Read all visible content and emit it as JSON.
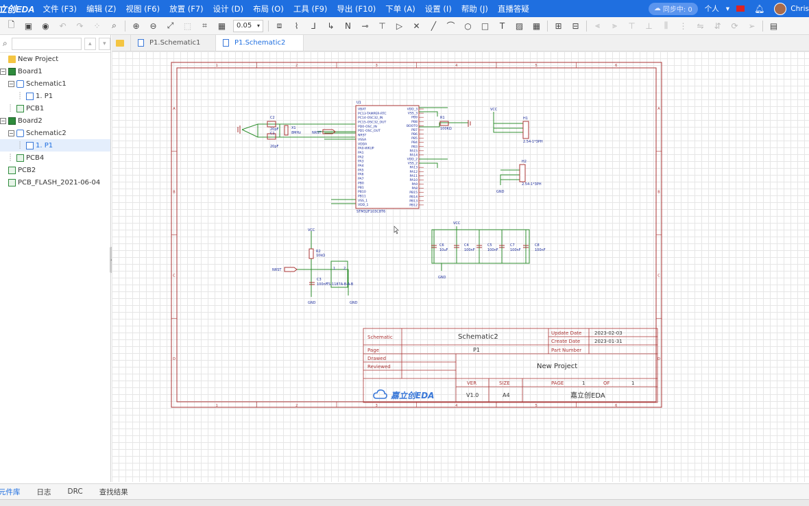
{
  "menubar": {
    "logo": "立创EDA",
    "items": [
      "文件 (F3)",
      "编辑 (Z)",
      "视图 (F6)",
      "放置 (F7)",
      "设计 (D)",
      "布局 (O)",
      "工具 (F9)",
      "导出 (F10)",
      "下单 (A)",
      "设置 (I)",
      "帮助 (J)",
      "直播答疑"
    ],
    "sync_label": "同步中: 0",
    "personal_label": "个人",
    "user_name": "Chris"
  },
  "toolbar": {
    "zoom_value": "0.05"
  },
  "left_panel": {
    "tree": [
      {
        "label": "New Project",
        "type": "folder",
        "level": 0
      },
      {
        "label": "Board1",
        "type": "board",
        "level": 0
      },
      {
        "label": "Schematic1",
        "type": "schematic",
        "level": 1
      },
      {
        "label": "1. P1",
        "type": "page",
        "level": 2
      },
      {
        "label": "PCB1",
        "type": "pcb",
        "level": 1
      },
      {
        "label": "Board2",
        "type": "board",
        "level": 0
      },
      {
        "label": "Schematic2",
        "type": "schematic",
        "level": 1
      },
      {
        "label": "1. P1",
        "type": "page",
        "level": 2,
        "selected": true
      },
      {
        "label": "PCB4",
        "type": "pcb",
        "level": 1
      },
      {
        "label": "PCB2",
        "type": "pcb",
        "level": 0
      },
      {
        "label": "PCB_FLASH_2021-06-04",
        "type": "pcb",
        "level": 0
      }
    ]
  },
  "tabs": [
    {
      "label": "P1.Schematic1",
      "active": false
    },
    {
      "label": "P1.Schematic2",
      "active": true
    }
  ],
  "bottom_tabs": [
    "元件库",
    "日志",
    "DRC",
    "查找结果"
  ],
  "schematic": {
    "colors": {
      "frame": "#a33",
      "wire": "#2f8f2f",
      "part": "#a33",
      "text": "#1a2a9a"
    },
    "frame_cols": [
      "1",
      "2",
      "3",
      "4",
      "5",
      "6"
    ],
    "frame_rows": [
      "A",
      "B",
      "C",
      "D"
    ],
    "mcu": {
      "ref": "U1",
      "part": "STM32F103C8T6",
      "left_pins": [
        "VBAT",
        "PC13-TAMPER-RTC",
        "PC14-OSC32_IN",
        "PC15-OSC32_OUT",
        "PD0-OSC_IN",
        "PD1-OSC_OUT",
        "NRST",
        "VSSA",
        "VDDA",
        "PA0-WKUP",
        "PA1",
        "PA2",
        "PA3",
        "PA4",
        "PA5",
        "PA6",
        "PA7",
        "PB0",
        "PB1",
        "PB10",
        "PB11",
        "VSS_1",
        "VDD_1"
      ],
      "right_pins": [
        "VDD_3",
        "VSS_3",
        "PB9",
        "PB8",
        "BOOT0",
        "PB7",
        "PB6",
        "PB5",
        "PB4",
        "PB3",
        "PA15",
        "PA14",
        "VDD_2",
        "VSS_2",
        "PA13",
        "PA12",
        "PA11",
        "PA10",
        "PA9",
        "PA8",
        "PB15",
        "PB14",
        "PB13",
        "PB12"
      ]
    },
    "components": {
      "c2": {
        "ref": "C2",
        "value": "20pF"
      },
      "c1": {
        "ref": "C1",
        "value": "20pF"
      },
      "x1": {
        "ref": "X1",
        "value": "8MHz"
      },
      "r1": {
        "ref": "R1",
        "value": "100KΩ"
      },
      "r2": {
        "ref": "R2",
        "value": "10kΩ"
      },
      "c3": {
        "ref": "C3",
        "value": "100nF"
      },
      "sw": {
        "ref": "TS-1187A-B-A-B",
        "pin1": "1",
        "pin2": "2"
      },
      "h1": {
        "ref": "H1",
        "value": "2.54-1*3PH"
      },
      "h2": {
        "ref": "H2",
        "value": "2.54-1*3PH"
      },
      "c6": {
        "ref": "C6",
        "value": "10uF"
      },
      "c4": {
        "ref": "C4",
        "value": "100nF"
      },
      "c5": {
        "ref": "C5",
        "value": "100nF"
      },
      "c7": {
        "ref": "C7",
        "value": "100nF"
      },
      "c8": {
        "ref": "C8",
        "value": "100nF"
      }
    },
    "nets": {
      "nrst": "NRST",
      "vcc": "VCC",
      "gnd": "GND"
    },
    "title_block": {
      "schematic_label": "Schematic",
      "schematic_value": "Schematic2",
      "page_label": "Page",
      "page_value": "P1",
      "drawed_label": "Drawed",
      "reviewed_label": "Reviewed",
      "update_label": "Update Date",
      "update_value": "2023-02-03",
      "create_label": "Create Date",
      "create_value": "2023-01-31",
      "part_label": "Part Number",
      "project_name": "New Project",
      "ver_label": "VER",
      "ver_value": "V1.0",
      "size_label": "SIZE",
      "size_value": "A4",
      "page_no_label": "PAGE",
      "page_no": "1",
      "of_label": "OF",
      "page_total": "1",
      "company": "嘉立创EDA",
      "brand_logo": "嘉立创EDA"
    }
  }
}
